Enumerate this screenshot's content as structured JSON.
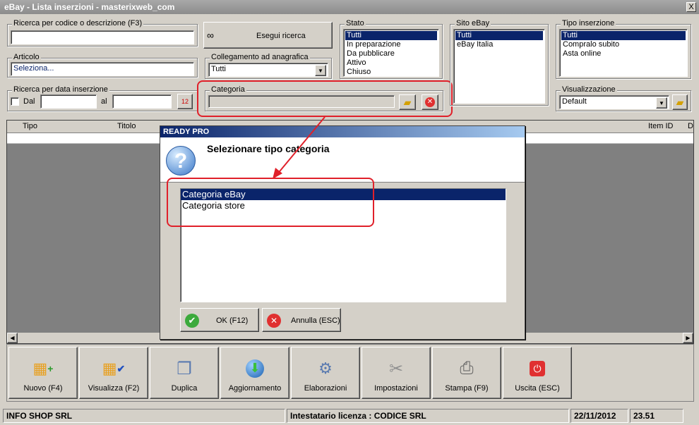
{
  "window": {
    "title": "eBay - Lista inserzioni - masterixweb_com",
    "close": "X"
  },
  "search": {
    "label": "Ricerca per codice o descrizione (F3)",
    "value": ""
  },
  "search_button": "Esegui ricerca",
  "articolo": {
    "label": "Articolo",
    "value": "Seleziona..."
  },
  "collegamento": {
    "label": "Collegamento ad anagrafica",
    "value": "Tutti"
  },
  "data_ins": {
    "label": "Ricerca per data inserzione",
    "dal": "Dal",
    "al": "al"
  },
  "categoria": {
    "label": "Categoria"
  },
  "stato": {
    "label": "Stato",
    "items": [
      "Tutti",
      "In preparazione",
      "Da pubblicare",
      "Attivo",
      "Chiuso"
    ]
  },
  "sito": {
    "label": "Sito eBay",
    "items": [
      "Tutti",
      "eBay Italia"
    ]
  },
  "tipo": {
    "label": "Tipo inserzione",
    "items": [
      "Tutti",
      "Compralo subito",
      "Asta online"
    ]
  },
  "visualizzazione": {
    "label": "Visualizzazione",
    "value": "Default"
  },
  "grid": {
    "columns": [
      "Tipo",
      "Titolo",
      "Item ID",
      "D"
    ]
  },
  "dialog": {
    "title": "READY PRO",
    "question": "Selezionare tipo categoria",
    "options": [
      "Categoria eBay",
      "Categoria store"
    ],
    "ok": "OK (F12)",
    "cancel": "Annulla (ESC)"
  },
  "toolbar": [
    "Nuovo (F4)",
    "Visualizza (F2)",
    "Duplica",
    "Aggiornamento",
    "Elaborazioni",
    "Impostazioni",
    "Stampa (F9)",
    "Uscita (ESC)"
  ],
  "status": {
    "company": "INFO SHOP SRL",
    "license": "Intestatario licenza : CODICE SRL",
    "date": "22/11/2012",
    "time": "23.51"
  }
}
